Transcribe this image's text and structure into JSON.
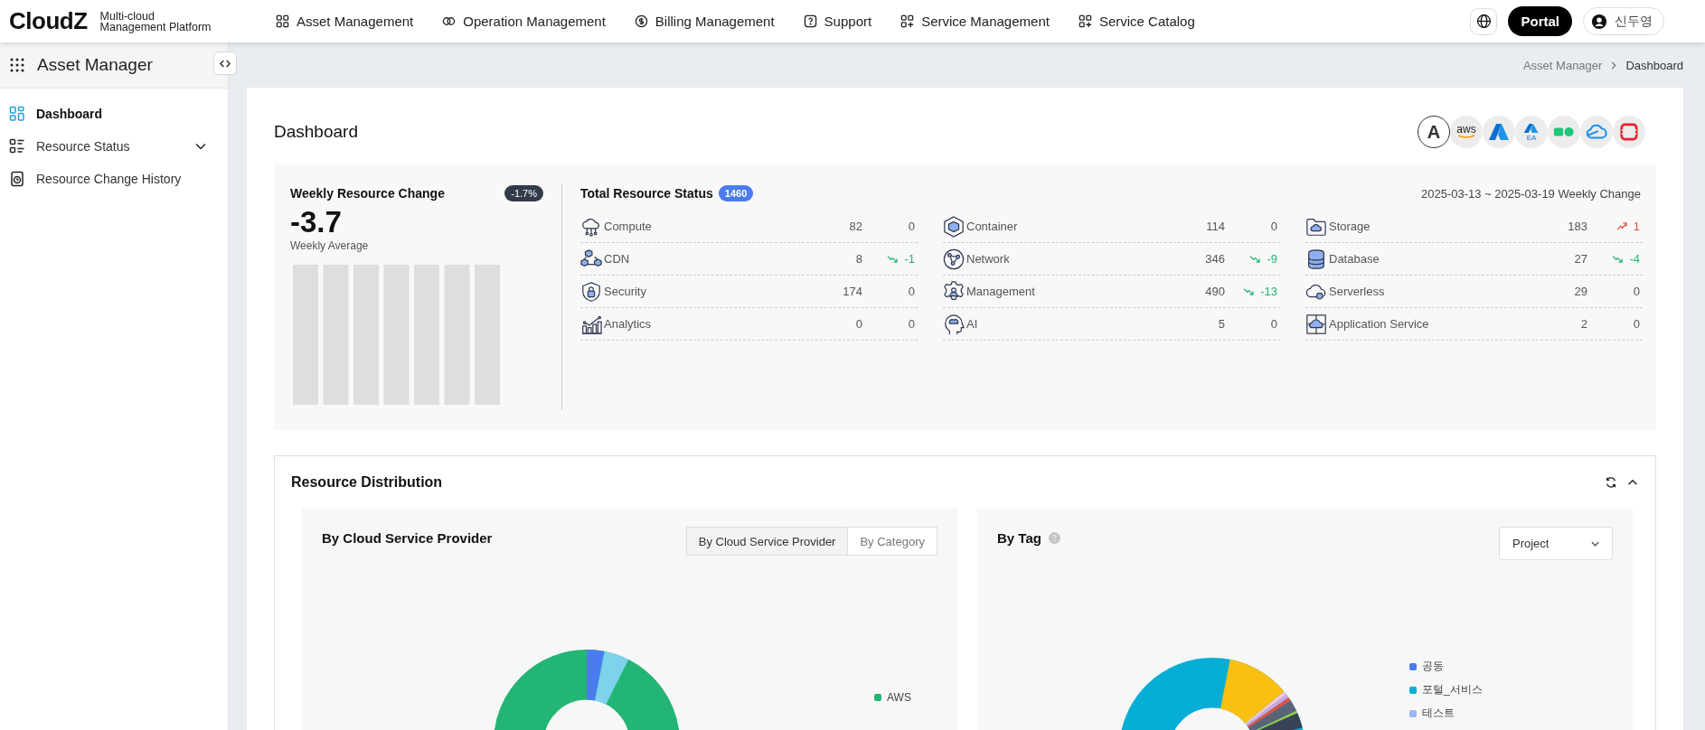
{
  "header": {
    "logo": "CloudZ",
    "tagline": [
      "Multi-cloud",
      "Management Platform"
    ],
    "nav": [
      {
        "label": "Asset Management"
      },
      {
        "label": "Operation Management"
      },
      {
        "label": "Billing Management"
      },
      {
        "label": "Support"
      },
      {
        "label": "Service Management"
      },
      {
        "label": "Service Catalog"
      }
    ],
    "portal_button": "Portal",
    "user": "신두영"
  },
  "sidebar": {
    "title": "Asset Manager",
    "items": [
      {
        "label": "Dashboard",
        "selected": true,
        "expandable": false
      },
      {
        "label": "Resource Status",
        "selected": false,
        "expandable": true
      },
      {
        "label": "Resource Change History",
        "selected": false,
        "expandable": false
      }
    ]
  },
  "breadcrumb": [
    "Asset Manager",
    "Dashboard"
  ],
  "page_title": "Dashboard",
  "providers": [
    {
      "kind": "letter",
      "label": "A",
      "selected": true
    },
    {
      "kind": "wordmark",
      "label": "aws",
      "selected": false
    },
    {
      "kind": "peak",
      "selected": false
    },
    {
      "kind": "peak-label",
      "label": "EA",
      "selected": false
    },
    {
      "kind": "blocks",
      "selected": false
    },
    {
      "kind": "cloud",
      "selected": false
    },
    {
      "kind": "frame",
      "selected": false
    }
  ],
  "weekly": {
    "title": "Weekly Resource Change",
    "badge": "-1.7%",
    "value": "-3.7",
    "caption": "Weekly Average"
  },
  "total": {
    "title": "Total Resource Status",
    "count": "1460",
    "period": "2025-03-13 ~ 2025-03-19 Weekly Change",
    "columns": [
      [
        {
          "name": "Compute",
          "count": "82",
          "change": "0",
          "kind": "flat"
        },
        {
          "name": "CDN",
          "count": "8",
          "change": "-1",
          "kind": "down"
        },
        {
          "name": "Security",
          "count": "174",
          "change": "0",
          "kind": "flat"
        },
        {
          "name": "Analytics",
          "count": "0",
          "change": "0",
          "kind": "flat"
        }
      ],
      [
        {
          "name": "Container",
          "count": "114",
          "change": "0",
          "kind": "flat"
        },
        {
          "name": "Network",
          "count": "346",
          "change": "-9",
          "kind": "down"
        },
        {
          "name": "Management",
          "count": "490",
          "change": "-13",
          "kind": "down"
        },
        {
          "name": "AI",
          "count": "5",
          "change": "0",
          "kind": "flat"
        }
      ],
      [
        {
          "name": "Storage",
          "count": "183",
          "change": "1",
          "kind": "up"
        },
        {
          "name": "Database",
          "count": "27",
          "change": "-4",
          "kind": "down"
        },
        {
          "name": "Serverless",
          "count": "29",
          "change": "0",
          "kind": "flat"
        },
        {
          "name": "Application Service",
          "count": "2",
          "change": "0",
          "kind": "flat"
        }
      ]
    ]
  },
  "distribution": {
    "title": "Resource Distribution",
    "by_provider": {
      "title": "By Cloud Service Provider",
      "toggle": [
        {
          "label": "By Cloud Service Provider",
          "selected": true
        },
        {
          "label": "By Category",
          "selected": false
        }
      ],
      "legend": [
        {
          "label": "AWS",
          "color": "#22b573"
        }
      ]
    },
    "by_tag": {
      "title": "By Tag",
      "dropdown": "Project",
      "legend": [
        {
          "label": "공동",
          "color": "#4a7cf0"
        },
        {
          "label": "포털_서비스",
          "color": "#06aed5"
        },
        {
          "label": "테스트",
          "color": "#9bb8f5"
        }
      ]
    }
  }
}
